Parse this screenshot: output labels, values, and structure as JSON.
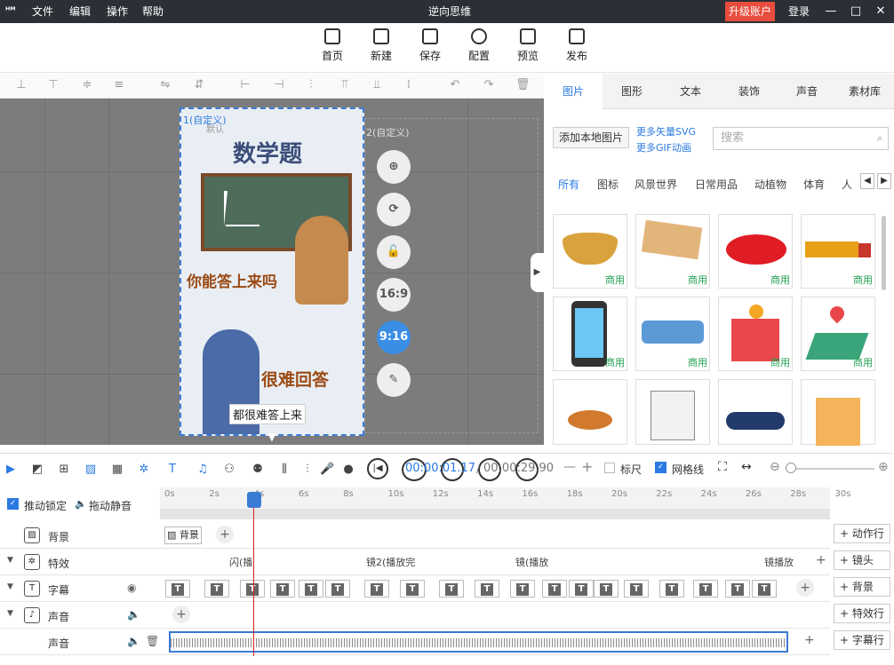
{
  "app": {
    "title": "逆向思维",
    "logo": "ᴴᴹ"
  },
  "menu": [
    "文件",
    "编辑",
    "操作",
    "帮助"
  ],
  "header": {
    "upgrade": "升级账户",
    "login": "登录"
  },
  "toolbar": [
    {
      "label": "首页",
      "icon": "home-icon"
    },
    {
      "label": "新建",
      "icon": "new-icon"
    },
    {
      "label": "保存",
      "icon": "save-icon"
    },
    {
      "label": "配置",
      "icon": "settings-icon"
    },
    {
      "label": "预览",
      "icon": "preview-icon"
    },
    {
      "label": "发布",
      "icon": "publish-icon"
    }
  ],
  "canvas": {
    "scene1_label": "1(自定义)",
    "scene1_sub": "默认",
    "scene2_label": "2(自定义)",
    "title_text": "数学题",
    "q_text": "你能答上来吗",
    "a_text": "很难回答",
    "caption": "都很难答上来",
    "ratio_169": "16:9",
    "ratio_916": "9:16"
  },
  "right_panel": {
    "tabs": [
      "图片",
      "图形",
      "文本",
      "装饰",
      "声音",
      "素材库"
    ],
    "add_local": "添加本地图片",
    "more_svg": "更多矢量SVG",
    "more_gif": "更多GIF动画",
    "search_placeholder": "搜索",
    "categories": [
      "所有",
      "图标",
      "风景世界",
      "日常用品",
      "动植物",
      "体育",
      "人"
    ],
    "badge": "商用"
  },
  "timeline": {
    "time_current": "00:00:01.17",
    "time_total": "00:00:29.90",
    "ruler_label": "标尺",
    "grid_label": "网格线",
    "lock_label": "推动锁定",
    "mute_label": "拖动静音",
    "ticks": [
      "0s",
      "2s",
      "4s",
      "6s",
      "8s",
      "10s",
      "12s",
      "14s",
      "16s",
      "18s",
      "20s",
      "22s",
      "24s",
      "26s",
      "28s",
      "30s"
    ],
    "rows": {
      "bg": "背景",
      "fx": "特效",
      "caption": "字幕",
      "sound": "声音",
      "sound2": "声音"
    },
    "bg_clip": "背景",
    "fx_clips": [
      "闪(播",
      "镜2(播放完",
      "镜(播放",
      "镜播放"
    ],
    "right_buttons": [
      "动作行",
      "镜头",
      "背景",
      "特效行",
      "字幕行"
    ]
  }
}
